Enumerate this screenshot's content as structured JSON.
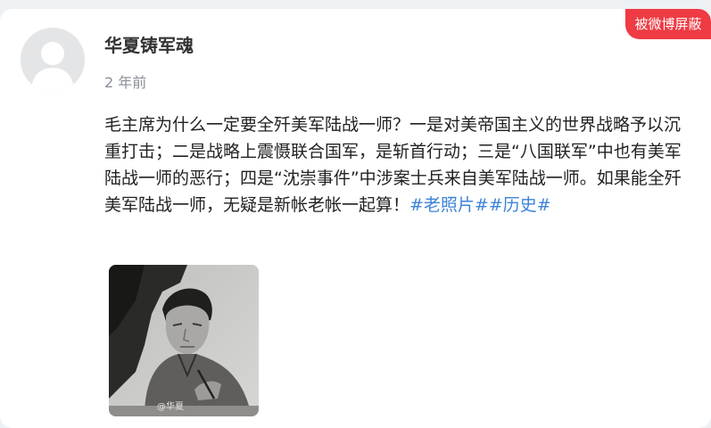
{
  "badge": {
    "label": "被微博屏蔽",
    "color": "#ef3b43"
  },
  "author": {
    "name": "华夏铸军魂",
    "time": "2 年前"
  },
  "post": {
    "text": "毛主席为什么一定要全歼美军陆战一师？一是对美帝国主义的世界战略予以沉重打击；二是战略上震慑联合国军，是斩首行动；三是“八国联军”中也有美军陆战一师的恶行；四是“沈崇事件”中涉案士兵来自美军陆战一师。如果能全歼美军陆战一师，无疑是新帐老帐一起算！",
    "hashtags": [
      "#老照片#",
      "#历史#"
    ]
  },
  "image": {
    "watermark": "@华夏"
  },
  "colors": {
    "hashtag": "#3f83d8",
    "background": "#eef1f4"
  }
}
